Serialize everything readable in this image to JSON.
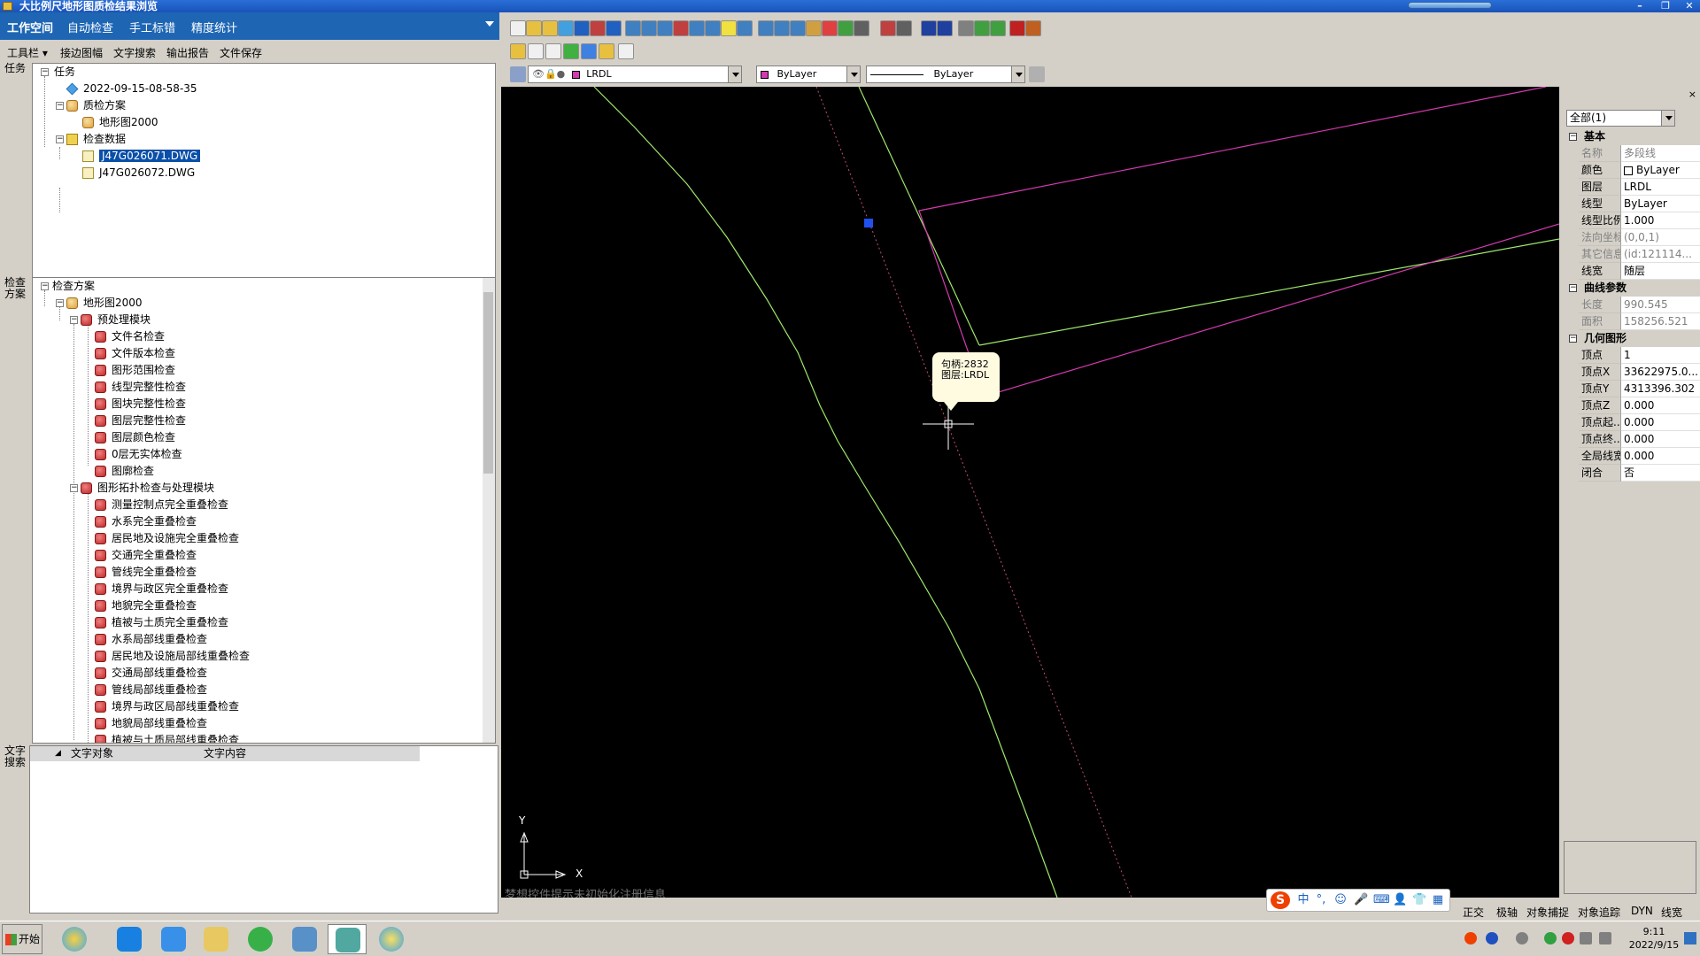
{
  "window": {
    "title": "大比例尺地形图质检结果浏览"
  },
  "menubar": {
    "tabs": [
      "工作空间",
      "自动检查",
      "手工标错",
      "精度统计"
    ]
  },
  "subtoolbar": {
    "items": [
      "工具栏 ▾",
      "接边图幅",
      "文字搜索",
      "输出报告",
      "文件保存"
    ]
  },
  "side_labels": {
    "task": "任务",
    "scheme": "检查\n方案",
    "text_search": "文字\n搜索"
  },
  "task_tree": {
    "root": "任务",
    "task_time": "2022-09-15-08-58-35",
    "qc_plan": "质检方案",
    "qc_plan_child": "地形图2000",
    "check_data": "检查数据",
    "files": [
      "J47G026071.DWG",
      "J47G026072.DWG"
    ]
  },
  "scheme_tree": {
    "root": "检查方案",
    "plan": "地形图2000",
    "module1": "预处理模块",
    "module1_items": [
      "文件名检查",
      "文件版本检查",
      "图形范围检查",
      "线型完整性检查",
      "图块完整性检查",
      "图层完整性检查",
      "图层颜色检查",
      "0层无实体检查",
      "图廓检查"
    ],
    "module2": "图形拓扑检查与处理模块",
    "module2_items": [
      "测量控制点完全重叠检查",
      "水系完全重叠检查",
      "居民地及设施完全重叠检查",
      "交通完全重叠检查",
      "管线完全重叠检查",
      "境界与政区完全重叠检查",
      "地貌完全重叠检查",
      "植被与土质完全重叠检查",
      "水系局部线重叠检查",
      "居民地及设施局部线重叠检查",
      "交通局部线重叠检查",
      "管线局部线重叠检查",
      "境界与政区局部线重叠检查",
      "地貌局部线重叠检查",
      "植被与土质局部线重叠检查"
    ]
  },
  "text_search": {
    "col_object": "文字对象",
    "col_content": "文字内容"
  },
  "cad_toolbar": {
    "layer_combo": "LRDL",
    "color_combo": "ByLayer",
    "linetype_combo": "ByLayer"
  },
  "canvas": {
    "tooltip_handle": "句柄:2832",
    "tooltip_layer": "图层:LRDL",
    "ucs_y": "Y",
    "ucs_x": "X",
    "message": "梦想控件提示未初始化注册信息"
  },
  "properties": {
    "selector": "全部(1)",
    "cat_basic": "基本",
    "basic": [
      {
        "name": "名称",
        "value": "多段线",
        "gray": true
      },
      {
        "name": "颜色",
        "value": "ByLayer",
        "gray": false,
        "checkbox": true
      },
      {
        "name": "图层",
        "value": "LRDL",
        "gray": false
      },
      {
        "name": "线型",
        "value": "ByLayer",
        "gray": false
      },
      {
        "name": "线型比例",
        "value": "1.000",
        "gray": false
      },
      {
        "name": "法向坐标",
        "value": "(0,0,1)",
        "gray": true
      },
      {
        "name": "其它信息",
        "value": "(id:121114...",
        "gray": true
      },
      {
        "name": "线宽",
        "value": "随层",
        "gray": false
      }
    ],
    "cat_curve": "曲线参数",
    "curve": [
      {
        "name": "长度",
        "value": "990.545",
        "gray": true
      },
      {
        "name": "面积",
        "value": "158256.521",
        "gray": true
      }
    ],
    "cat_geom": "几何图形",
    "geom": [
      {
        "name": "顶点",
        "value": "1",
        "gray": false
      },
      {
        "name": "顶点X",
        "value": "33622975.0...",
        "gray": false
      },
      {
        "name": "顶点Y",
        "value": "4313396.302",
        "gray": false
      },
      {
        "name": "顶点Z",
        "value": "0.000",
        "gray": false
      },
      {
        "name": "顶点起...",
        "value": "0.000",
        "gray": false
      },
      {
        "name": "顶点终...",
        "value": "0.000",
        "gray": false
      },
      {
        "name": "全局线宽",
        "value": "0.000",
        "gray": false
      },
      {
        "name": "闭合",
        "value": "否",
        "gray": false
      }
    ]
  },
  "statusbar": {
    "items": [
      "正交",
      "极轴",
      "对象捕捉",
      "对象追踪",
      "DYN",
      "线宽"
    ]
  },
  "ime": {
    "items": [
      "中",
      "°,",
      "☺",
      "🎤",
      "⌨",
      "👤",
      "👕",
      "▦"
    ]
  },
  "taskbar": {
    "start": "开始",
    "time": "9:11",
    "date": "2022/9/15"
  },
  "colors": {
    "menubar": "#1e66b4",
    "canvas": "#000000",
    "green_line": "#9ee86a",
    "magenta_line": "#d43ab0",
    "dashed_line": "#c0506a",
    "selection_grip": "#2050f0"
  }
}
